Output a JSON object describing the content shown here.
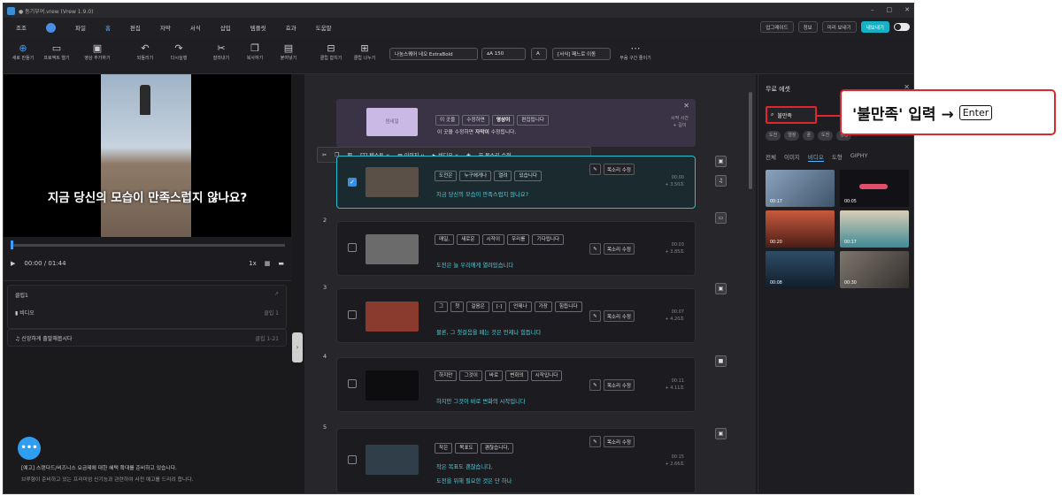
{
  "window": {
    "title": "● 동기부여.vrew (Vrew 1.9.0)"
  },
  "menu": {
    "items": [
      "조조",
      "파일",
      "홈",
      "편집",
      "자막",
      "서식",
      "삽입",
      "템플릿",
      "효과",
      "도움말"
    ],
    "active_index": 2,
    "right": [
      "업그레이드",
      "정보",
      "미리 보내기",
      "내보내기"
    ]
  },
  "toolbar": {
    "new_project": "새로 만들기",
    "open_project": "프로젝트 열기",
    "add_video": "영상 추가하기",
    "undo": "되돌리기",
    "redo": "다시실행",
    "cut": "잘라내기",
    "copy": "복사하기",
    "paste": "붙여넣기",
    "clip_merge": "클립 합치기",
    "clip_split": "클립 나누기",
    "font": "나눔스퀘어 네오 ExtraBold",
    "font_size": "150",
    "style": "[서식] 패느로 이동",
    "silence": "무음 구간 줄이기"
  },
  "video": {
    "caption": "지금 당신의 모습이 만족스럽지 않나요?"
  },
  "player": {
    "time": "00:00 / 01:44",
    "speed": "1x"
  },
  "clipinfo": {
    "title": "클립1",
    "video_label": "비디오",
    "video_value": "클립 1",
    "music_label": "신앙하게 출발해봅시다",
    "music_value": "클립 1-21"
  },
  "notice": {
    "line1": "[예고] 스탠다드/비즈니스 요금제에 대한 혜택 확대를 준비하고 있습니다.",
    "line2": "브루형이 준비하고 있는 프리미엄 신기능과 관련하여 사전 예고를 드리려 합니다."
  },
  "intro": {
    "thumb": "썸네일",
    "chips": [
      "이 곳을",
      "수정하면",
      "영상이",
      "편집됩니다"
    ],
    "sub_prefix": "이 곳을 수정하면 ",
    "sub_bold": "자막이",
    "sub_suffix": " 수정됩니다.",
    "side_top": "시작 시간",
    "side_bottom": "+ 길이"
  },
  "floatbar": {
    "items": [
      "텍스트",
      "이미지",
      "비디오",
      "목소리 수정"
    ]
  },
  "clips": [
    {
      "num": "",
      "chips": [
        "도전은",
        "누구에게나",
        "열려",
        "있습니다"
      ],
      "sub": "지금 당신의 모습이 만족스럽지 않나요?",
      "time1": "00:00",
      "time2": "+ 3.50초",
      "voice": "목소리 수정"
    },
    {
      "num": "2",
      "chips": [
        "매일,",
        "새로운",
        "시작이",
        "우리를",
        "기다립니다"
      ],
      "sub": "도전은 늘 우리에게 열려있습니다",
      "time1": "00:03",
      "time2": "+ 3.85초",
      "voice": "목소리 수정"
    },
    {
      "num": "3",
      "chips": [
        "그",
        "첫",
        "걸음은",
        "[-]",
        "언제나",
        "가장",
        "힘듭니다"
      ],
      "sub": "물론, 그 첫걸음을 떼는 것은 언제나 힘듭니다",
      "time1": "00:07",
      "time2": "+ 4.20초",
      "voice": "목소리 수정"
    },
    {
      "num": "4",
      "chips": [
        "하지만",
        "그것이",
        "바로",
        "변화의",
        "시작입니다"
      ],
      "sub": "하지만 그것이 바로 변화의 시작입니다",
      "time1": "00:11",
      "time2": "+ 4.11초",
      "voice": "목소리 수정"
    },
    {
      "num": "5",
      "chips": [
        "작은",
        "목표도",
        "괜찮습니다,"
      ],
      "sub": "작은 목표도 괜찮습니다,",
      "sub2": "도전을 위해 필요한 것은 단 하나",
      "time1": "00:15",
      "time2": "+ 2.66초",
      "voice": "목소리 수정"
    }
  ],
  "assets_panel": {
    "title": "무료 에셋",
    "search_value": "불만족",
    "tags": [
      "도전",
      "열정",
      "꿈",
      "도전",
      "성공"
    ],
    "tabs": [
      "전체",
      "이미지",
      "비디오",
      "도형",
      "GIPHY"
    ],
    "active_tab": "비디오",
    "items": [
      {
        "duration": "00:17",
        "color": "#4a6178"
      },
      {
        "duration": "00:05",
        "color": "#111116"
      },
      {
        "duration": "00:20",
        "color": "#8a3b2b"
      },
      {
        "duration": "00:17",
        "color": "#c9bba3"
      },
      {
        "duration": "00:08",
        "color": "#1d3a52"
      },
      {
        "duration": "00:30",
        "color": "#5e5a55"
      }
    ]
  },
  "callout": {
    "text": "'불만족' 입력 →",
    "key": "Enter"
  },
  "colors": {
    "accent": "#16b1c4",
    "highlight": "#e0252f",
    "subtitle": "#4fd1e0"
  }
}
